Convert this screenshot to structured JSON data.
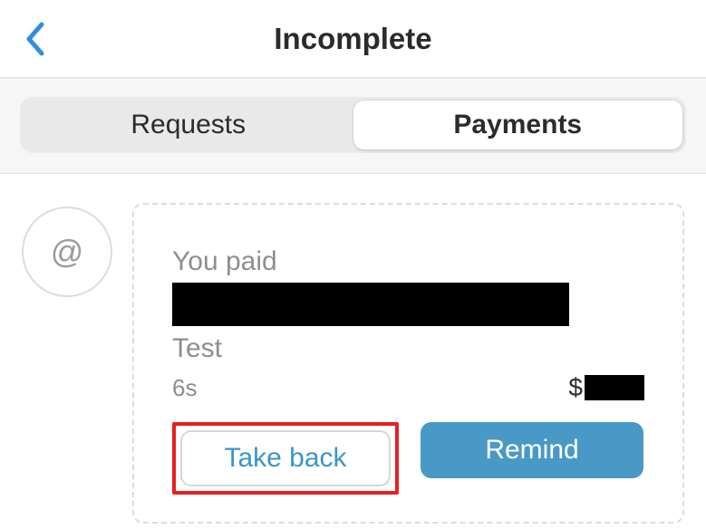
{
  "header": {
    "title": "Incomplete"
  },
  "tabs": {
    "requests": "Requests",
    "payments": "Payments"
  },
  "avatar": {
    "glyph": "@"
  },
  "transaction": {
    "you_paid": "You paid",
    "note": "Test",
    "timestamp": "6s",
    "currency": "$"
  },
  "actions": {
    "take_back": "Take back",
    "remind": "Remind"
  }
}
